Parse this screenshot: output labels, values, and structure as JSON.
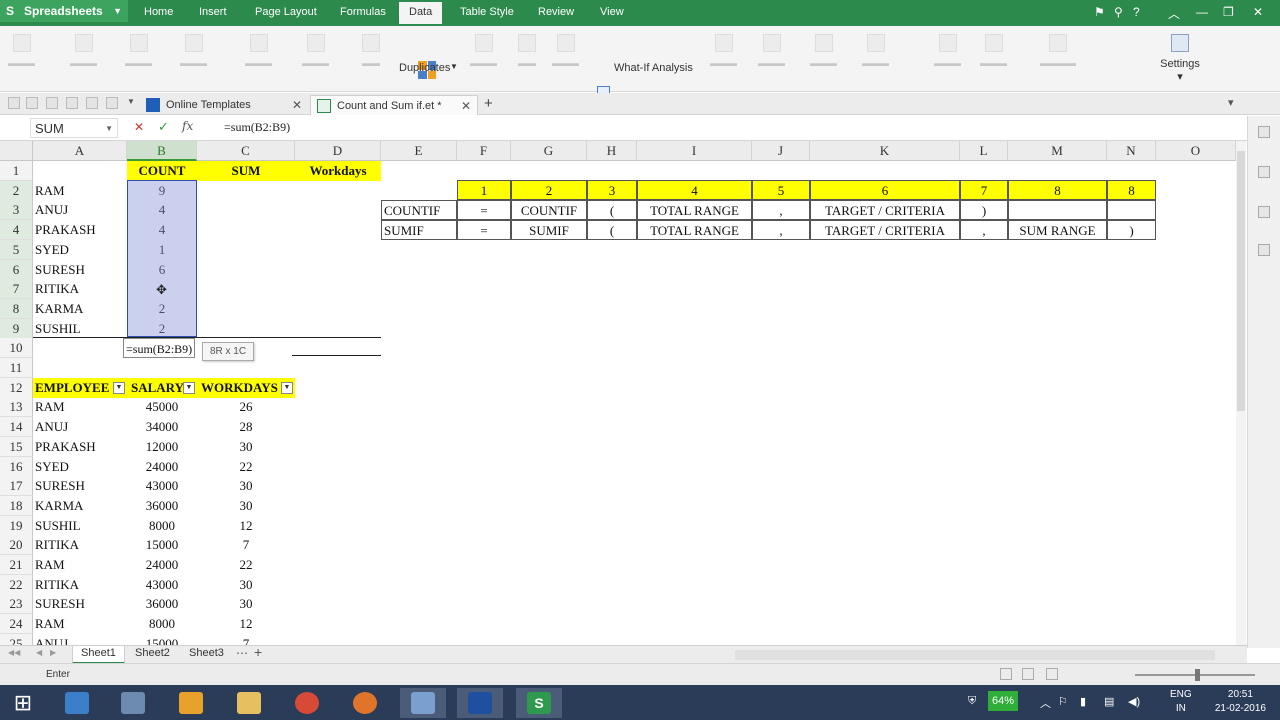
{
  "menubar": {
    "app_name": "Spreadsheets",
    "items": [
      "Home",
      "Insert",
      "Page Layout",
      "Formulas",
      "Data",
      "Table Style",
      "Review",
      "View"
    ],
    "active_item": "Data",
    "accent": "#2d8a4d"
  },
  "ribbon": {
    "duplicates": "Duplicates",
    "what_if": "What-If Analysis",
    "settings": "Settings"
  },
  "tabs": {
    "online_templates": "Online Templates",
    "document": "Count and Sum if.et *"
  },
  "formula_bar": {
    "name_box": "SUM",
    "formula": "=sum(B2:B9)"
  },
  "columns": [
    "A",
    "B",
    "C",
    "D",
    "E",
    "F",
    "G",
    "H",
    "I",
    "J",
    "K",
    "L",
    "M",
    "N",
    "O"
  ],
  "rows": [
    "1",
    "2",
    "3",
    "4",
    "5",
    "6",
    "7",
    "8",
    "9",
    "10",
    "11",
    "12",
    "13",
    "14",
    "15",
    "16",
    "17",
    "18",
    "19",
    "20",
    "21",
    "22",
    "23",
    "24",
    "25"
  ],
  "sheet": {
    "header": {
      "count": "COUNT",
      "sum": "SUM",
      "workdays": "Workdays"
    },
    "names_top": [
      "RAM",
      "ANUJ",
      "PRAKASH",
      "SYED",
      "SURESH",
      "RITIKA",
      "KARMA",
      "SUSHIL"
    ],
    "counts": [
      "9",
      "4",
      "4",
      "1",
      "6",
      "",
      "2",
      "2"
    ],
    "editing_formula": "=sum(B2:B9)",
    "selection_tip": "8R x 1C",
    "ref_header": [
      "1",
      "2",
      "3",
      "4",
      "5",
      "6",
      "7",
      "8",
      "8"
    ],
    "countif_row": [
      "COUNTIF",
      "=",
      "COUNTIF",
      "(",
      "TOTAL RANGE",
      ",",
      "TARGET / CRITERIA",
      ")",
      "",
      ""
    ],
    "sumif_row": [
      "SUMIF",
      "=",
      "SUMIF",
      "(",
      "TOTAL RANGE",
      ",",
      "TARGET / CRITERIA",
      ",",
      "SUM RANGE",
      ")"
    ],
    "table_header": [
      "EMPLOYEE",
      "SALARY",
      "WORKDAYS"
    ],
    "table_rows": [
      [
        "RAM",
        "45000",
        "26"
      ],
      [
        "ANUJ",
        "34000",
        "28"
      ],
      [
        "PRAKASH",
        "12000",
        "30"
      ],
      [
        "SYED",
        "24000",
        "22"
      ],
      [
        "SURESH",
        "43000",
        "30"
      ],
      [
        "KARMA",
        "36000",
        "30"
      ],
      [
        "SUSHIL",
        "8000",
        "12"
      ],
      [
        "RITIKA",
        "15000",
        "7"
      ],
      [
        "RAM",
        "24000",
        "22"
      ],
      [
        "RITIKA",
        "43000",
        "30"
      ],
      [
        "SURESH",
        "36000",
        "30"
      ],
      [
        "RAM",
        "8000",
        "12"
      ],
      [
        "ANUJ",
        "15000",
        "7"
      ]
    ]
  },
  "sheet_tabs": [
    "Sheet1",
    "Sheet2",
    "Sheet3"
  ],
  "status": {
    "mode": "Enter"
  },
  "taskbar": {
    "battery": "64%",
    "lang": "ENG",
    "region": "IN",
    "time": "20:51",
    "date": "21-02-2016"
  }
}
